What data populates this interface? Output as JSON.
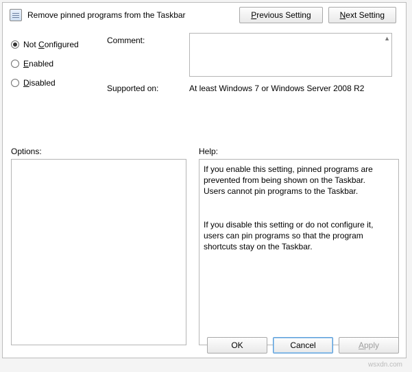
{
  "header": {
    "title": "Remove pinned programs from the Taskbar",
    "previous_setting_label": "Previous Setting",
    "next_setting_label": "Next Setting"
  },
  "state": {
    "not_configured_label": "Not Configured",
    "enabled_label": "Enabled",
    "disabled_label": "Disabled",
    "selected": "not_configured"
  },
  "labels": {
    "comment": "Comment:",
    "supported_on": "Supported on:",
    "options": "Options:",
    "help": "Help:"
  },
  "fields": {
    "comment_value": "",
    "supported_on_value": "At least Windows 7 or Windows Server 2008 R2",
    "options_value": "",
    "help_value": "If you enable this setting, pinned programs are prevented from being shown on the Taskbar. Users cannot pin programs to the Taskbar.\n\n\nIf you disable this setting or do not configure it, users can pin programs so that the program shortcuts stay on the Taskbar."
  },
  "buttons": {
    "ok": "OK",
    "cancel": "Cancel",
    "apply": "Apply"
  },
  "watermark": "wsxdn.com"
}
